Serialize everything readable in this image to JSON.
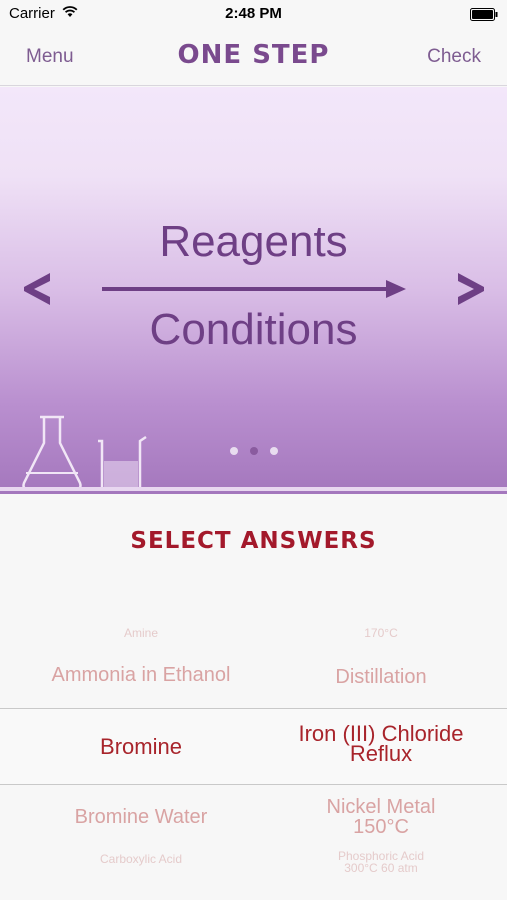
{
  "status_bar": {
    "carrier": "Carrier",
    "time": "2:48 PM"
  },
  "nav": {
    "left": "Menu",
    "title": "ONE STEP",
    "right": "Check"
  },
  "hero": {
    "reagents_label": "Reagents",
    "conditions_label": "Conditions",
    "page_count": 3,
    "active_page": 2
  },
  "section": {
    "title": "SELECT ANSWERS"
  },
  "picker": {
    "left_column": [
      "Amine",
      "Ammonia in Ethanol",
      "Bromine",
      "Bromine Water",
      "Carboxylic Acid"
    ],
    "right_column": [
      "170°C",
      "Distillation",
      "Iron (III) Chloride Reflux",
      "Nickel Metal 150°C",
      "Phosphoric Acid 300°C 60 atm"
    ],
    "right_lines": {
      "selected_line1": "Iron (III) Chloride",
      "selected_line2": "Reflux",
      "below_line1": "Nickel Metal",
      "below_line2": "150°C",
      "far_line1": "Phosphoric Acid",
      "far_line2": "300°C 60 atm"
    }
  },
  "colors": {
    "accent_purple": "#7a4a8e",
    "answer_red": "#a3192b"
  }
}
